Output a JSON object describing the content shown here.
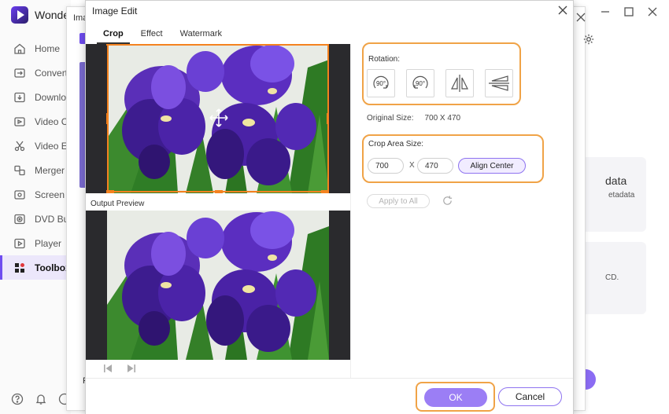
{
  "app": {
    "brand": "Wonder",
    "nav": [
      {
        "label": "Home",
        "icon": "home-icon"
      },
      {
        "label": "Converter",
        "icon": "converter-icon"
      },
      {
        "label": "Downloader",
        "icon": "download-icon"
      },
      {
        "label": "Video Compressor",
        "icon": "video-compress-icon"
      },
      {
        "label": "Video Editor",
        "icon": "scissors-icon"
      },
      {
        "label": "Merger",
        "icon": "merge-icon"
      },
      {
        "label": "Screen Recorder",
        "icon": "screen-record-icon"
      },
      {
        "label": "DVD Burner",
        "icon": "dvd-icon"
      },
      {
        "label": "Player",
        "icon": "play-icon"
      },
      {
        "label": "Toolbox",
        "icon": "toolbox-icon",
        "active": true
      }
    ],
    "background_peek": {
      "dialog_title": "Ima",
      "footer_fragment": "F",
      "card1_title": "data",
      "card1_sub": "etadata",
      "card2_sub": "CD.",
      "button_fragment": "t"
    }
  },
  "dialog": {
    "title": "Image Edit",
    "tabs": [
      {
        "label": "Crop",
        "active": true
      },
      {
        "label": "Effect",
        "active": false
      },
      {
        "label": "Watermark",
        "active": false
      }
    ],
    "output_preview_label": "Output Preview",
    "rotation": {
      "label": "Rotation:",
      "buttons": [
        {
          "name": "rotate-right-button",
          "text": "90°"
        },
        {
          "name": "rotate-left-button",
          "text": "90°"
        },
        {
          "name": "flip-horizontal-button",
          "text": ""
        },
        {
          "name": "flip-vertical-button",
          "text": ""
        }
      ]
    },
    "original_size": {
      "label": "Original Size:",
      "value": "700 X 470"
    },
    "crop_area": {
      "label": "Crop Area Size:",
      "width": "700",
      "separator": "X",
      "height": "470",
      "align_center": "Align Center"
    },
    "apply_to_all": "Apply to All",
    "ok": "OK",
    "cancel": "Cancel"
  },
  "colors": {
    "accent": "#8e73f0",
    "primary_button": "#9b7ef5",
    "highlight_outline": "#f0a347",
    "crop_frame": "#f4821f",
    "preview_background": "#2a2a2d"
  }
}
